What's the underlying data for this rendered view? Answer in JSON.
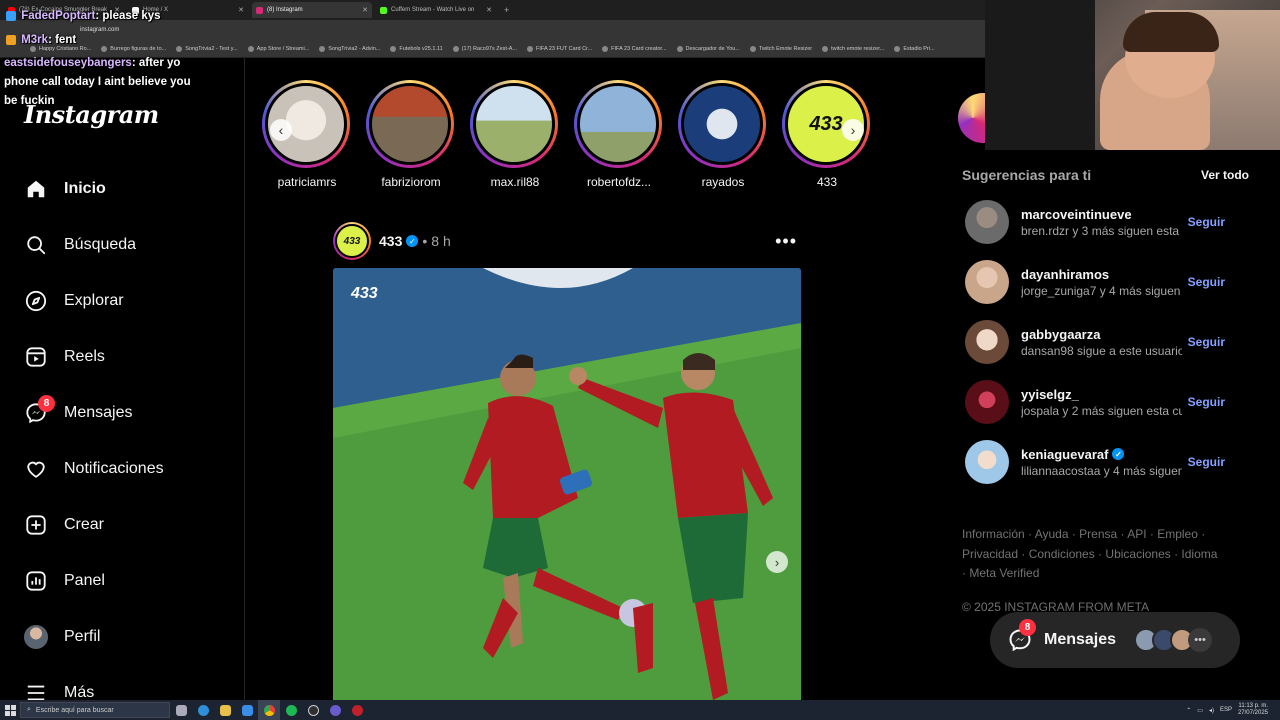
{
  "browser": {
    "tabs": [
      {
        "label": "(78) Ex-Cocaine Smuggler Break",
        "color": "#ff0000",
        "active": false
      },
      {
        "label": "Home / X",
        "color": "#ffffff",
        "active": false
      },
      {
        "label": "(8) Instagram",
        "color": "#d62976",
        "active": true
      },
      {
        "label": "Cuffem Stream - Watch Live on",
        "color": "#53fc18",
        "active": false
      }
    ],
    "url": "instagram.com",
    "bookmarks": [
      "Happy Cristiano Ro...",
      "Burrego figuras de to...",
      "SongTrivia2 - Test y...",
      "App Store / Streami...",
      "SongTrivia2 - Advin...",
      "Futebols v25.1.11",
      "(17) Raco97s Zest-A...",
      "FIFA 23 FUT Card Cr...",
      "FIFA 23 Card creator...",
      "Descargador de You...",
      "Twitch Emote Resizer",
      "twitch emote resizer...",
      "Estadio Pri..."
    ]
  },
  "chat": [
    {
      "user": "FadedPoptart",
      "message": ": please kys"
    },
    {
      "user": "M3rk",
      "message": ": fent"
    },
    {
      "user": "eastsidefouseybangers",
      "message": ": after yo"
    },
    {
      "user": "",
      "message": "phone call today I aint believe you"
    },
    {
      "user": "",
      "message": "be fuckin"
    }
  ],
  "sidebar": {
    "logo": "Instagram",
    "items": [
      {
        "label": "Inicio",
        "icon": "home-icon"
      },
      {
        "label": "Búsqueda",
        "icon": "search-icon"
      },
      {
        "label": "Explorar",
        "icon": "compass-icon"
      },
      {
        "label": "Reels",
        "icon": "reels-icon"
      },
      {
        "label": "Mensajes",
        "icon": "messenger-icon",
        "badge": "8"
      },
      {
        "label": "Notificaciones",
        "icon": "heart-icon"
      },
      {
        "label": "Crear",
        "icon": "plus-square-icon"
      },
      {
        "label": "Panel",
        "icon": "chart-icon"
      },
      {
        "label": "Perfil",
        "icon": "avatar"
      },
      {
        "label": "Más",
        "icon": "menu-icon"
      }
    ]
  },
  "stories": [
    {
      "name": "patriciamrs",
      "color": "#c9c2b8"
    },
    {
      "name": "fabriziorom",
      "color": "#7a6a55"
    },
    {
      "name": "max.ril88",
      "color": "#9bb0c8"
    },
    {
      "name": "robertofdz...",
      "color": "#8fb3d9"
    },
    {
      "name": "rayados",
      "color": "#1b3d7a"
    },
    {
      "name": "433",
      "color": "#dcf04a"
    }
  ],
  "post": {
    "username": "433",
    "avatar_text": "433",
    "time": "8 h",
    "watermark": "433"
  },
  "suggestions": {
    "title": "Sugerencias para ti",
    "see_all": "Ver todo",
    "follow_label": "Seguir",
    "items": [
      {
        "name": "marcoveintinueve",
        "sub": "bren.rdzr y 3 más siguen esta cu...",
        "verified": false,
        "color": "#6b6b6b"
      },
      {
        "name": "dayanhiramos",
        "sub": "jorge_zuniga7 y 4 más siguen es...",
        "verified": false,
        "color": "#c9a58a"
      },
      {
        "name": "gabbygaarza",
        "sub": "dansan98 sigue a este usuario",
        "verified": false,
        "color": "#e8d0c4"
      },
      {
        "name": "yyiselgz_",
        "sub": "jospala y 2 más siguen esta cue...",
        "verified": false,
        "color": "#8a1a22"
      },
      {
        "name": "keniaguevaraf",
        "sub": "liliannaacostaa y 4 más siguen e...",
        "verified": true,
        "color": "#9fc8e8"
      }
    ]
  },
  "footer": {
    "links": "Información · Ayuda · Prensa · API · Empleo · Privacidad · Condiciones · Ubicaciones · Idioma · Meta Verified",
    "copyright": "© 2025 INSTAGRAM FROM META"
  },
  "messages_pill": {
    "label": "Mensajes",
    "badge": "8"
  },
  "taskbar": {
    "search_placeholder": "Escribe aquí para buscar",
    "lang": "ESP",
    "time": "11:13 p. m.",
    "date": "27/07/2025"
  },
  "colors": {
    "accent": "#0095f6",
    "follow": "#85a1ff",
    "badge": "#ff3040"
  }
}
